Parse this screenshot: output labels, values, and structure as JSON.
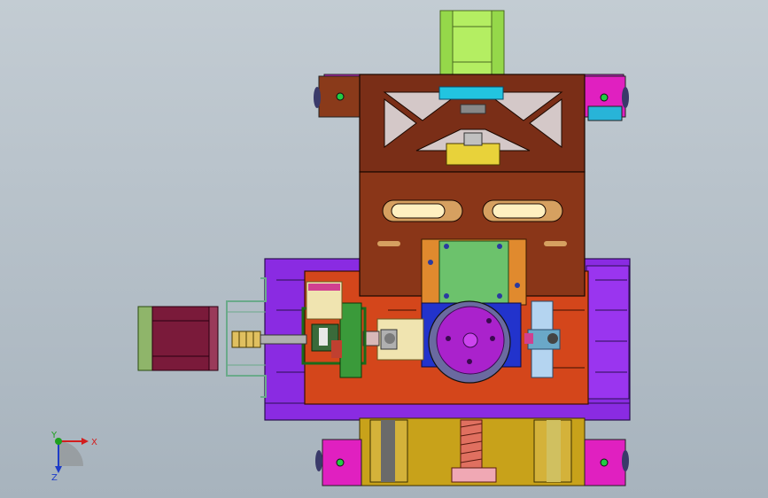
{
  "viewport": {
    "background_top": "#c3ccd3",
    "background_bottom": "#a7b3bd"
  },
  "triad": {
    "x_label": "X",
    "y_label": "Y",
    "z_label": "Z",
    "x_color": "#d21e1e",
    "y_color": "#1ea01e",
    "z_color": "#1e3cc8"
  },
  "colors": {
    "base_plate": "#8a2be2",
    "orange_plate": "#d4461b",
    "brown_bracket": "#7a2e17",
    "motor_body": "#7a1a3a",
    "motor_face": "#8fb56a",
    "green_block": "#6cc26c",
    "cyan_bar": "#22c4e0",
    "yellow_part": "#e8d23a",
    "gold_bed": "#c8a21a",
    "blue_housing": "#2233cc",
    "magenta_disk": "#aa22cc",
    "pink_pad": "#e020c0"
  }
}
